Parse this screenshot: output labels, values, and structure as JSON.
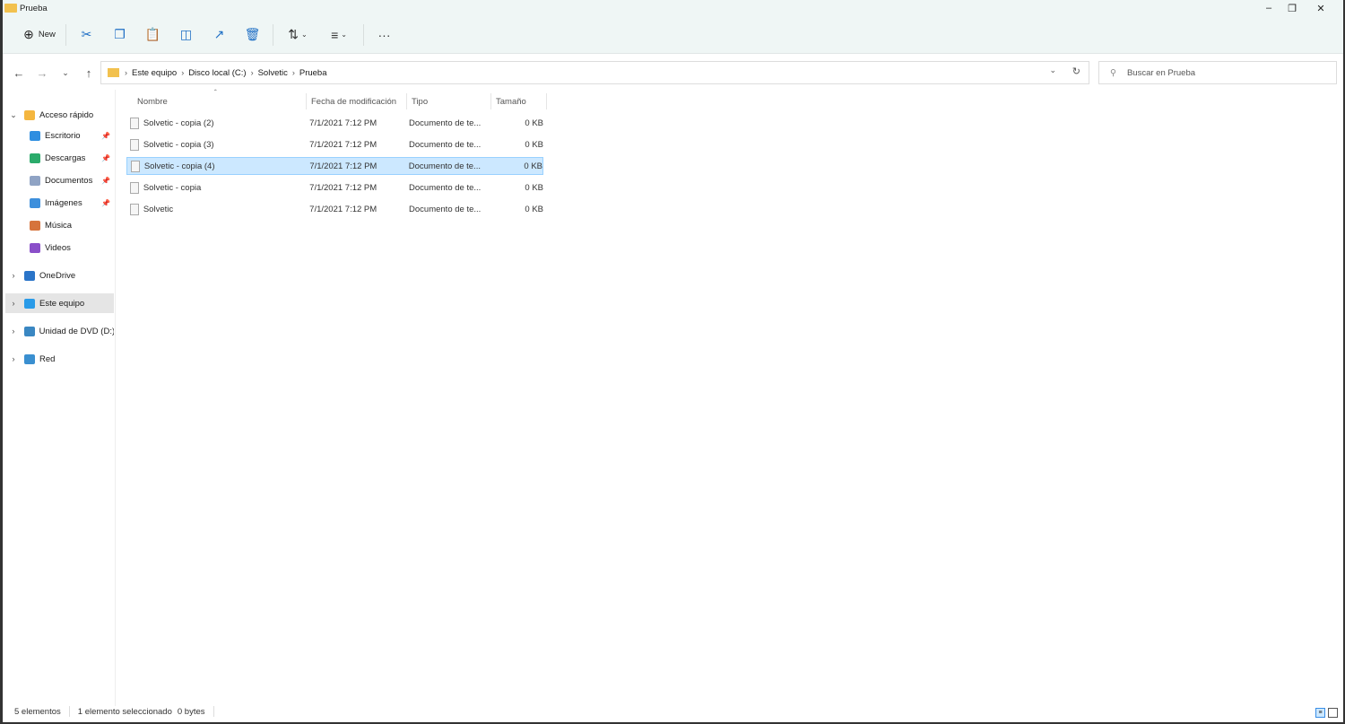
{
  "window": {
    "title": "Prueba"
  },
  "toolbar": {
    "new_label": "New",
    "more": "···"
  },
  "address": {
    "breadcrumbs": [
      "Este equipo",
      "Disco local (C:)",
      "Solvetic",
      "Prueba"
    ]
  },
  "search": {
    "placeholder": "Buscar en Prueba"
  },
  "sidebar": {
    "items": [
      {
        "label": "Acceso rápido",
        "icon": "star-icon",
        "expand": "expanded",
        "color": "#f4b63f"
      },
      {
        "label": "Escritorio",
        "icon": "desktop-icon",
        "pinned": true,
        "color": "#2f8ee0"
      },
      {
        "label": "Descargas",
        "icon": "download-icon",
        "pinned": true,
        "color": "#2bab6b"
      },
      {
        "label": "Documentos",
        "icon": "documents-icon",
        "pinned": true,
        "color": "#8fa3c4"
      },
      {
        "label": "Imágenes",
        "icon": "pictures-icon",
        "pinned": true,
        "color": "#3d8fdc"
      },
      {
        "label": "Música",
        "icon": "music-icon",
        "color": "#d6733c"
      },
      {
        "label": "Videos",
        "icon": "videos-icon",
        "color": "#8a4fc9"
      },
      {
        "label": "OneDrive",
        "icon": "cloud-icon",
        "expand": "collapsed",
        "color": "#2a74c8"
      },
      {
        "label": "Este equipo",
        "icon": "computer-icon",
        "expand": "collapsed",
        "selected": true,
        "color": "#2a9be8"
      },
      {
        "label": "Unidad de DVD (D:)",
        "icon": "dvd-icon",
        "expand": "collapsed",
        "color": "#3a87c2"
      },
      {
        "label": "Red",
        "icon": "network-icon",
        "expand": "collapsed",
        "color": "#3a8fd0"
      }
    ]
  },
  "columns": [
    "Nombre",
    "Fecha de modificación",
    "Tipo",
    "Tamaño"
  ],
  "files": [
    {
      "name": "Solvetic - copia (2)",
      "date": "7/1/2021 7:12 PM",
      "type": "Documento de te...",
      "size": "0 KB"
    },
    {
      "name": "Solvetic - copia (3)",
      "date": "7/1/2021 7:12 PM",
      "type": "Documento de te...",
      "size": "0 KB"
    },
    {
      "name": "Solvetic - copia (4)",
      "date": "7/1/2021 7:12 PM",
      "type": "Documento de te...",
      "size": "0 KB",
      "selected": true
    },
    {
      "name": "Solvetic - copia",
      "date": "7/1/2021 7:12 PM",
      "type": "Documento de te...",
      "size": "0 KB"
    },
    {
      "name": "Solvetic",
      "date": "7/1/2021 7:12 PM",
      "type": "Documento de te...",
      "size": "0 KB"
    }
  ],
  "status": {
    "count": "5 elementos",
    "selection": "1 elemento seleccionado",
    "size": "0 bytes"
  }
}
